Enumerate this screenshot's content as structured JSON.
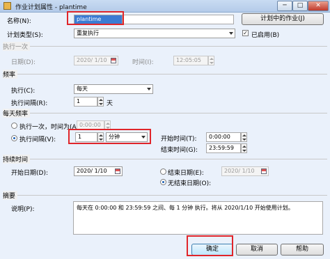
{
  "window": {
    "title": "作业计划属性 - plantime",
    "minimize": "─",
    "maximize": "□",
    "close": "✕"
  },
  "name_row": {
    "label": "名称(N):",
    "value": "plantime",
    "jobs_button": "计划中的作业(J)"
  },
  "plan_type": {
    "label": "计划类型(S):",
    "value": "重复执行",
    "enabled_label": "已启用(B)",
    "enabled": true
  },
  "one_time": {
    "section": "执行一次",
    "date_label": "日期(D):",
    "date_value": "2020/ 1/10",
    "time_label": "时间(I):",
    "time_value": "12:05:05"
  },
  "frequency": {
    "section": "频率",
    "execute_label": "执行(C):",
    "execute_value": "每天",
    "interval_label": "执行间隔(R):",
    "interval_value": "1",
    "interval_unit": "天"
  },
  "daily": {
    "section": "每天频率",
    "once_label": "执行一次，时间为(A):",
    "once_value": "0:00:00",
    "interval_label": "执行间隔(V):",
    "interval_value": "1",
    "interval_unit": "分钟",
    "start_label": "开始时间(T):",
    "start_value": "0:00:00",
    "end_label": "结束时间(G):",
    "end_value": "23:59:59"
  },
  "duration": {
    "section": "持续时间",
    "start_date_label": "开始日期(D):",
    "start_date_value": "2020/ 1/10",
    "end_date_label": "结束日期(E):",
    "end_date_value": "2020/ 1/10",
    "no_end_label": "无结束日期(O):"
  },
  "summary": {
    "section": "摘要",
    "desc_label": "说明(P):",
    "text": "每天在 0:00:00 和 23:59:59 之间、每 1 分钟 执行。将从 2020/1/10 开始使用计划。"
  },
  "buttons": {
    "ok": "确定",
    "cancel": "取消",
    "help": "帮助"
  }
}
